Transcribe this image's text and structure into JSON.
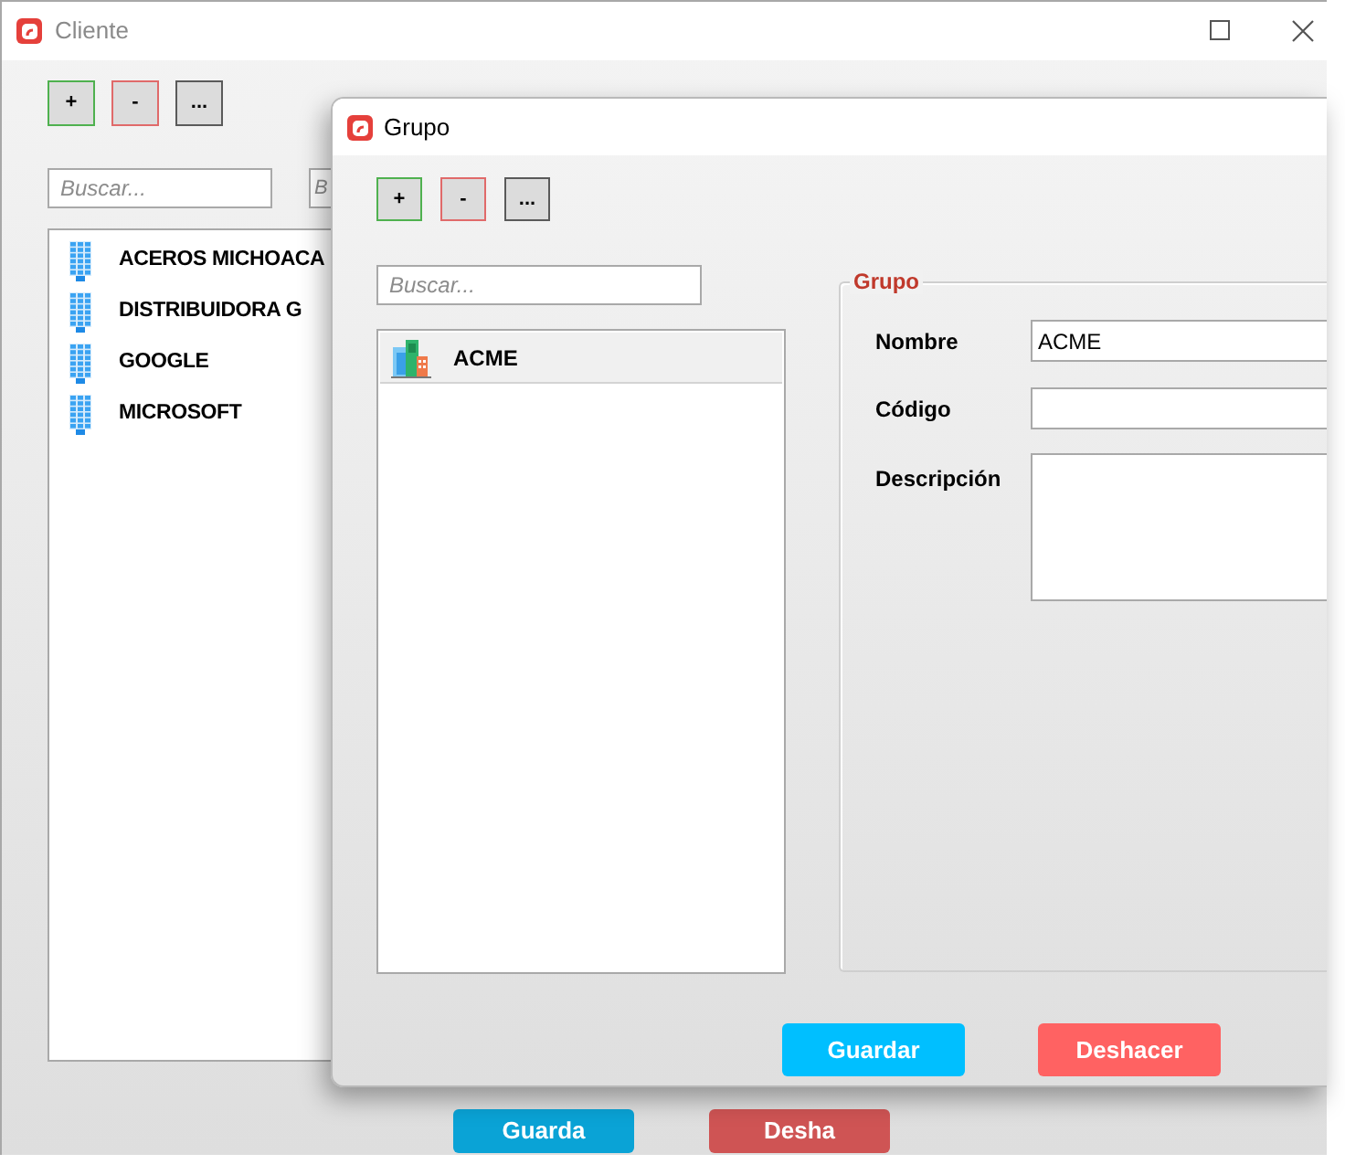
{
  "cliente_window": {
    "title": "Cliente",
    "toolbar": [
      {
        "label": "+",
        "kind": "add"
      },
      {
        "label": "-",
        "kind": "remove"
      },
      {
        "label": "...",
        "kind": "more"
      }
    ],
    "search_fields": [
      {
        "placeholder": "Buscar..."
      },
      {
        "placeholder": "B"
      }
    ],
    "list": [
      {
        "name": "ACEROS MICHOACA",
        "selected": false
      },
      {
        "name": "DISTRIBUIDORA G",
        "selected": false
      },
      {
        "name": "GOOGLE",
        "selected": false
      },
      {
        "name": "MICROSOFT",
        "selected": false
      }
    ],
    "buttons": [
      {
        "label": "Guarda",
        "kind": "save"
      },
      {
        "label": "Desha",
        "kind": "undo"
      }
    ]
  },
  "grupo_window": {
    "title": "Grupo",
    "toolbar": [
      {
        "label": "+",
        "kind": "add"
      },
      {
        "label": "-",
        "kind": "remove"
      },
      {
        "label": "...",
        "kind": "more"
      }
    ],
    "search": {
      "placeholder": "Buscar..."
    },
    "list": [
      {
        "name": "ACME",
        "selected": true
      }
    ],
    "form": {
      "title": "Grupo",
      "fields": [
        {
          "label": "Nombre",
          "kind": "text",
          "value": "ACME"
        },
        {
          "label": "Código",
          "kind": "text"
        },
        {
          "label": "Descripción",
          "kind": "textarea"
        }
      ]
    },
    "buttons": [
      {
        "label": "Guardar",
        "kind": "save"
      },
      {
        "label": "Deshacer",
        "kind": "undo"
      }
    ]
  }
}
